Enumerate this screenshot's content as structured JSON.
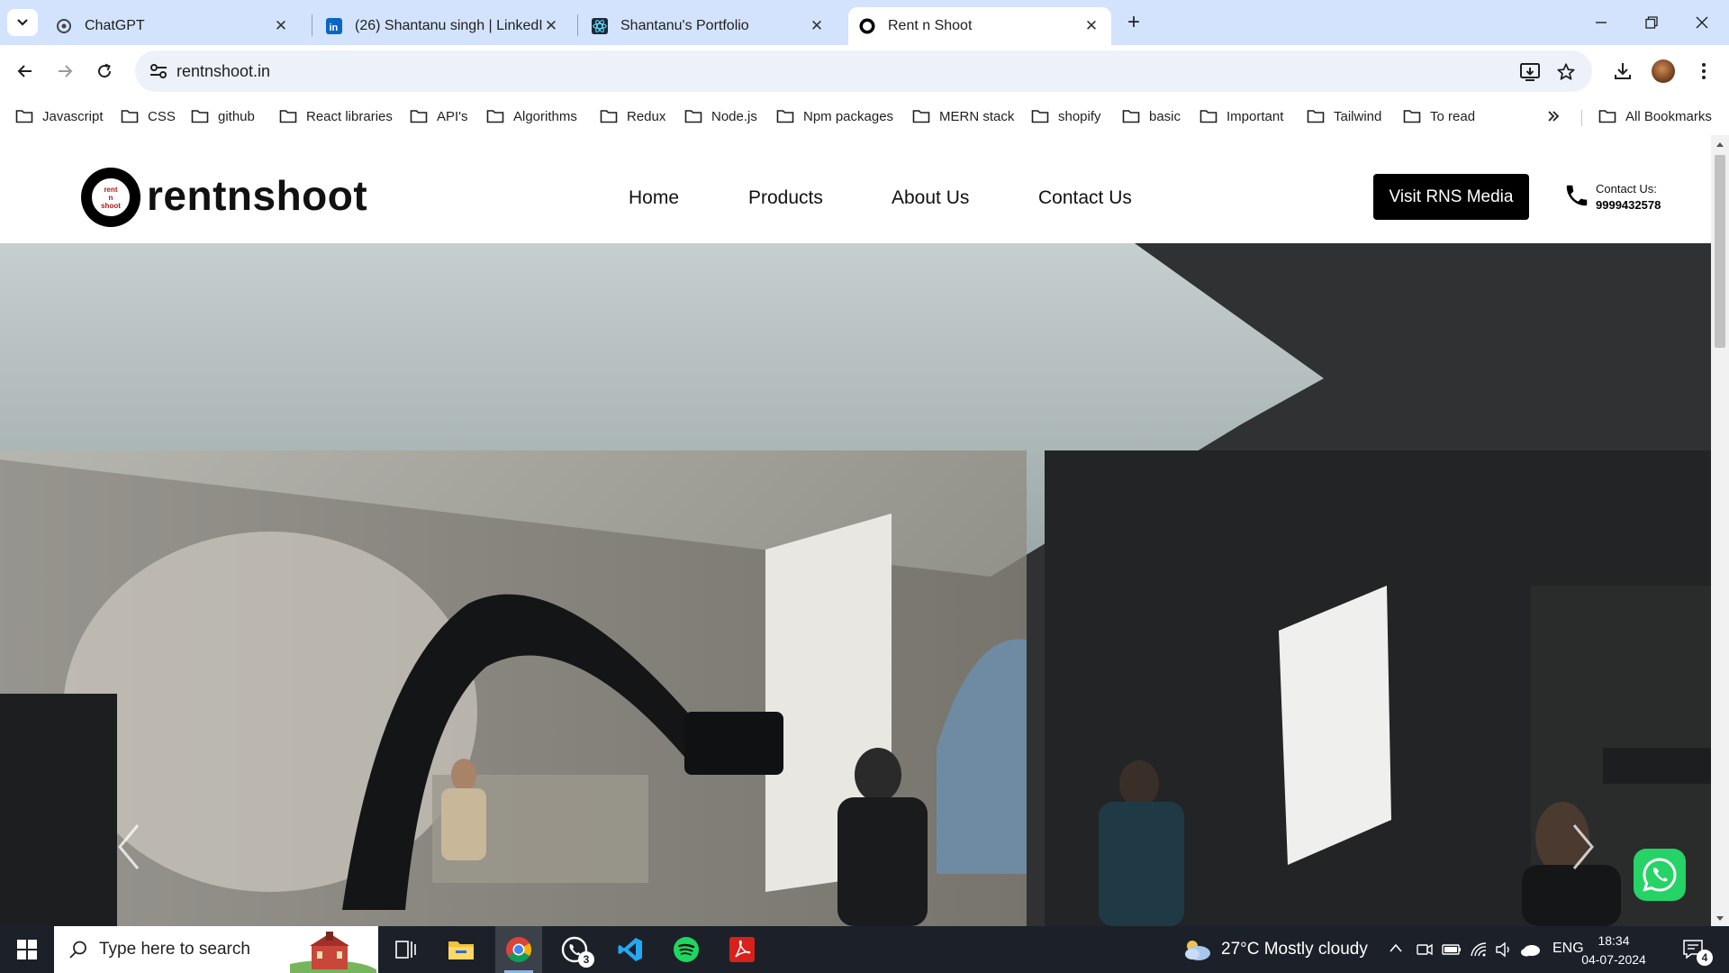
{
  "browser": {
    "tabs": [
      {
        "title": "ChatGPT",
        "icon": "chatgpt-icon"
      },
      {
        "title": "(26) Shantanu singh | LinkedIn",
        "icon": "linkedin-icon"
      },
      {
        "title": "Shantanu's Portfolio",
        "icon": "react-icon"
      },
      {
        "title": "Rent n Shoot",
        "icon": "rentnshoot-favicon",
        "active": true
      }
    ],
    "url": "rentnshoot.in",
    "bookmarks": [
      "Javascript",
      "CSS",
      "github",
      "React libraries",
      "API's",
      "Algorithms",
      "Redux",
      "Node.js",
      "Npm packages",
      "MERN stack",
      "shopify",
      "basic",
      "Important",
      "Tailwind",
      "To read"
    ],
    "all_bookmarks": "All Bookmarks"
  },
  "site": {
    "logo_text": "rentnshoot",
    "logo_badge": [
      "rent",
      "n",
      "shoot"
    ],
    "nav": [
      "Home",
      "Products",
      "About Us",
      "Contact Us"
    ],
    "cta": "Visit RNS Media",
    "contact_label": "Contact Us:",
    "contact_phone": "9999432578"
  },
  "taskbar": {
    "search_placeholder": "Type here to search",
    "whatsapp_badge": "3",
    "weather": "27°C  Mostly cloudy",
    "language": "ENG",
    "time": "18:34",
    "date": "04-07-2024",
    "notifications": "4"
  },
  "colors": {
    "tabstrip": "#d3e3fd",
    "cta_bg": "#000000",
    "whatsapp": "#25d366",
    "taskbar": "#1c2129"
  }
}
